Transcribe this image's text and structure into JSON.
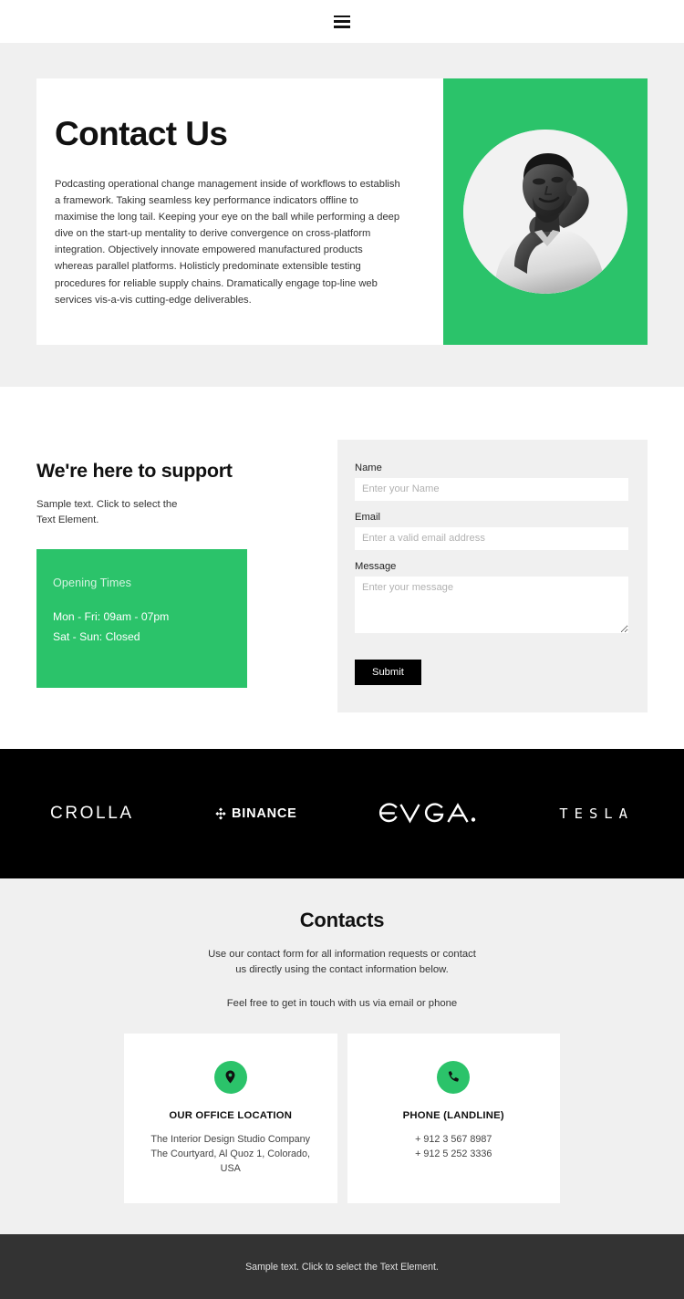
{
  "header": {
    "menu_icon": "hamburger-icon"
  },
  "hero": {
    "title": "Contact Us",
    "body": "Podcasting operational change management inside of workflows to establish a framework. Taking seamless key performance indicators offline to maximise the long tail. Keeping your eye on the ball while performing a deep dive on the start-up mentality to derive convergence on cross-platform integration. Objectively innovate empowered manufactured products whereas parallel platforms. Holisticly predominate extensible testing procedures for reliable supply chains. Dramatically engage top-line web services vis-a-vis cutting-edge deliverables.",
    "image_alt": "portrait-photo",
    "accent_color": "#2bc36a"
  },
  "support": {
    "title": "We're here to support",
    "subtitle": "Sample text. Click to select the Text Element.",
    "opening": {
      "heading": "Opening Times",
      "lines": [
        "Mon - Fri: 09am - 07pm",
        "Sat - Sun: Closed"
      ]
    }
  },
  "form": {
    "fields": [
      {
        "label": "Name",
        "placeholder": "Enter your Name",
        "value": "",
        "type": "text",
        "name": "name-field"
      },
      {
        "label": "Email",
        "placeholder": "Enter a valid email address",
        "value": "",
        "type": "email",
        "name": "email-field"
      },
      {
        "label": "Message",
        "placeholder": "Enter your message",
        "value": "",
        "type": "textarea",
        "name": "message-field"
      }
    ],
    "submit_label": "Submit"
  },
  "logos": {
    "items": [
      {
        "name": "crolla",
        "label": "CROLLA"
      },
      {
        "name": "binance",
        "label": "BINANCE"
      },
      {
        "name": "evga",
        "label": "EVGA"
      },
      {
        "name": "tesla",
        "label": "TESLA"
      }
    ]
  },
  "contacts": {
    "title": "Contacts",
    "lead": "Use our contact form for all information requests or contact us directly using the contact information below.",
    "lead2": "Feel free to get in touch with us via email or phone",
    "cards": [
      {
        "icon": "location-pin-icon",
        "title": "OUR OFFICE LOCATION",
        "lines": [
          "The Interior Design Studio Company",
          "The Courtyard, Al Quoz 1, Colorado,",
          "USA"
        ]
      },
      {
        "icon": "phone-icon",
        "title": "PHONE (LANDLINE)",
        "lines": [
          "+ 912 3 567 8987",
          "+ 912 5 252 3336"
        ]
      }
    ]
  },
  "footer": {
    "text": "Sample text. Click to select the Text Element."
  }
}
